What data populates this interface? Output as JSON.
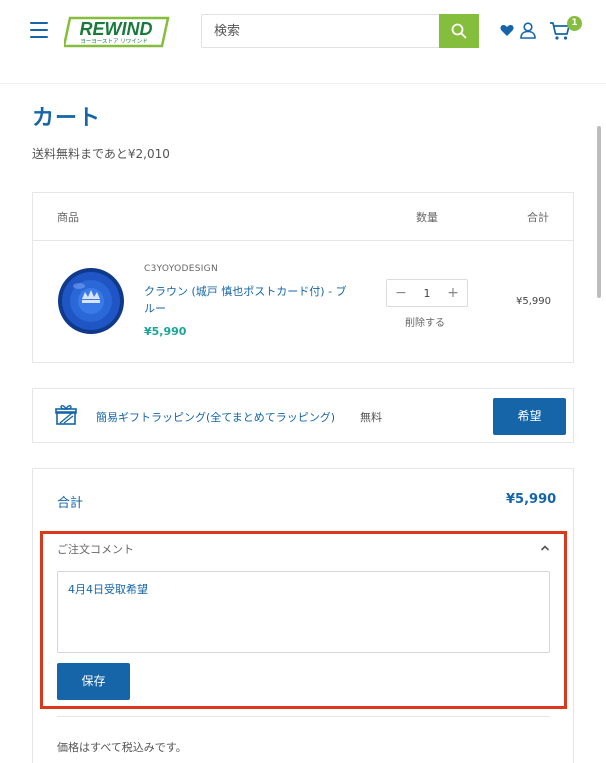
{
  "header": {
    "logo_text": "REWIND",
    "logo_subtext": "ヨーヨーストア リワインド",
    "search_placeholder": "検索",
    "cart_count": "1"
  },
  "page": {
    "title": "カート",
    "shipping_note": "送料無料まであと¥2,010"
  },
  "cart_table": {
    "headers": {
      "product": "商品",
      "quantity": "数量",
      "total": "合計"
    },
    "items": [
      {
        "vendor": "C3YOYODESIGN",
        "title": "クラウン (城戸 慎也ポストカード付) - ブルー",
        "price": "¥5,990",
        "quantity": "1",
        "remove_label": "削除する",
        "line_total": "¥5,990"
      }
    ]
  },
  "gift_wrap": {
    "label": "簡易ギフトラッピング(全てまとめてラッピング)",
    "price": "無料",
    "button_label": "希望"
  },
  "summary": {
    "total_label": "合計",
    "total_value": "¥5,990",
    "comment_label": "ご注文コメント",
    "comment_value": "4月4日受取希望",
    "save_label": "保存",
    "tax_note": "価格はすべて税込みです。"
  },
  "colors": {
    "brand_blue": "#1565a8",
    "brand_green": "#85bd3c",
    "price_teal": "#1aa59a",
    "highlight_red": "#d93a1e"
  }
}
